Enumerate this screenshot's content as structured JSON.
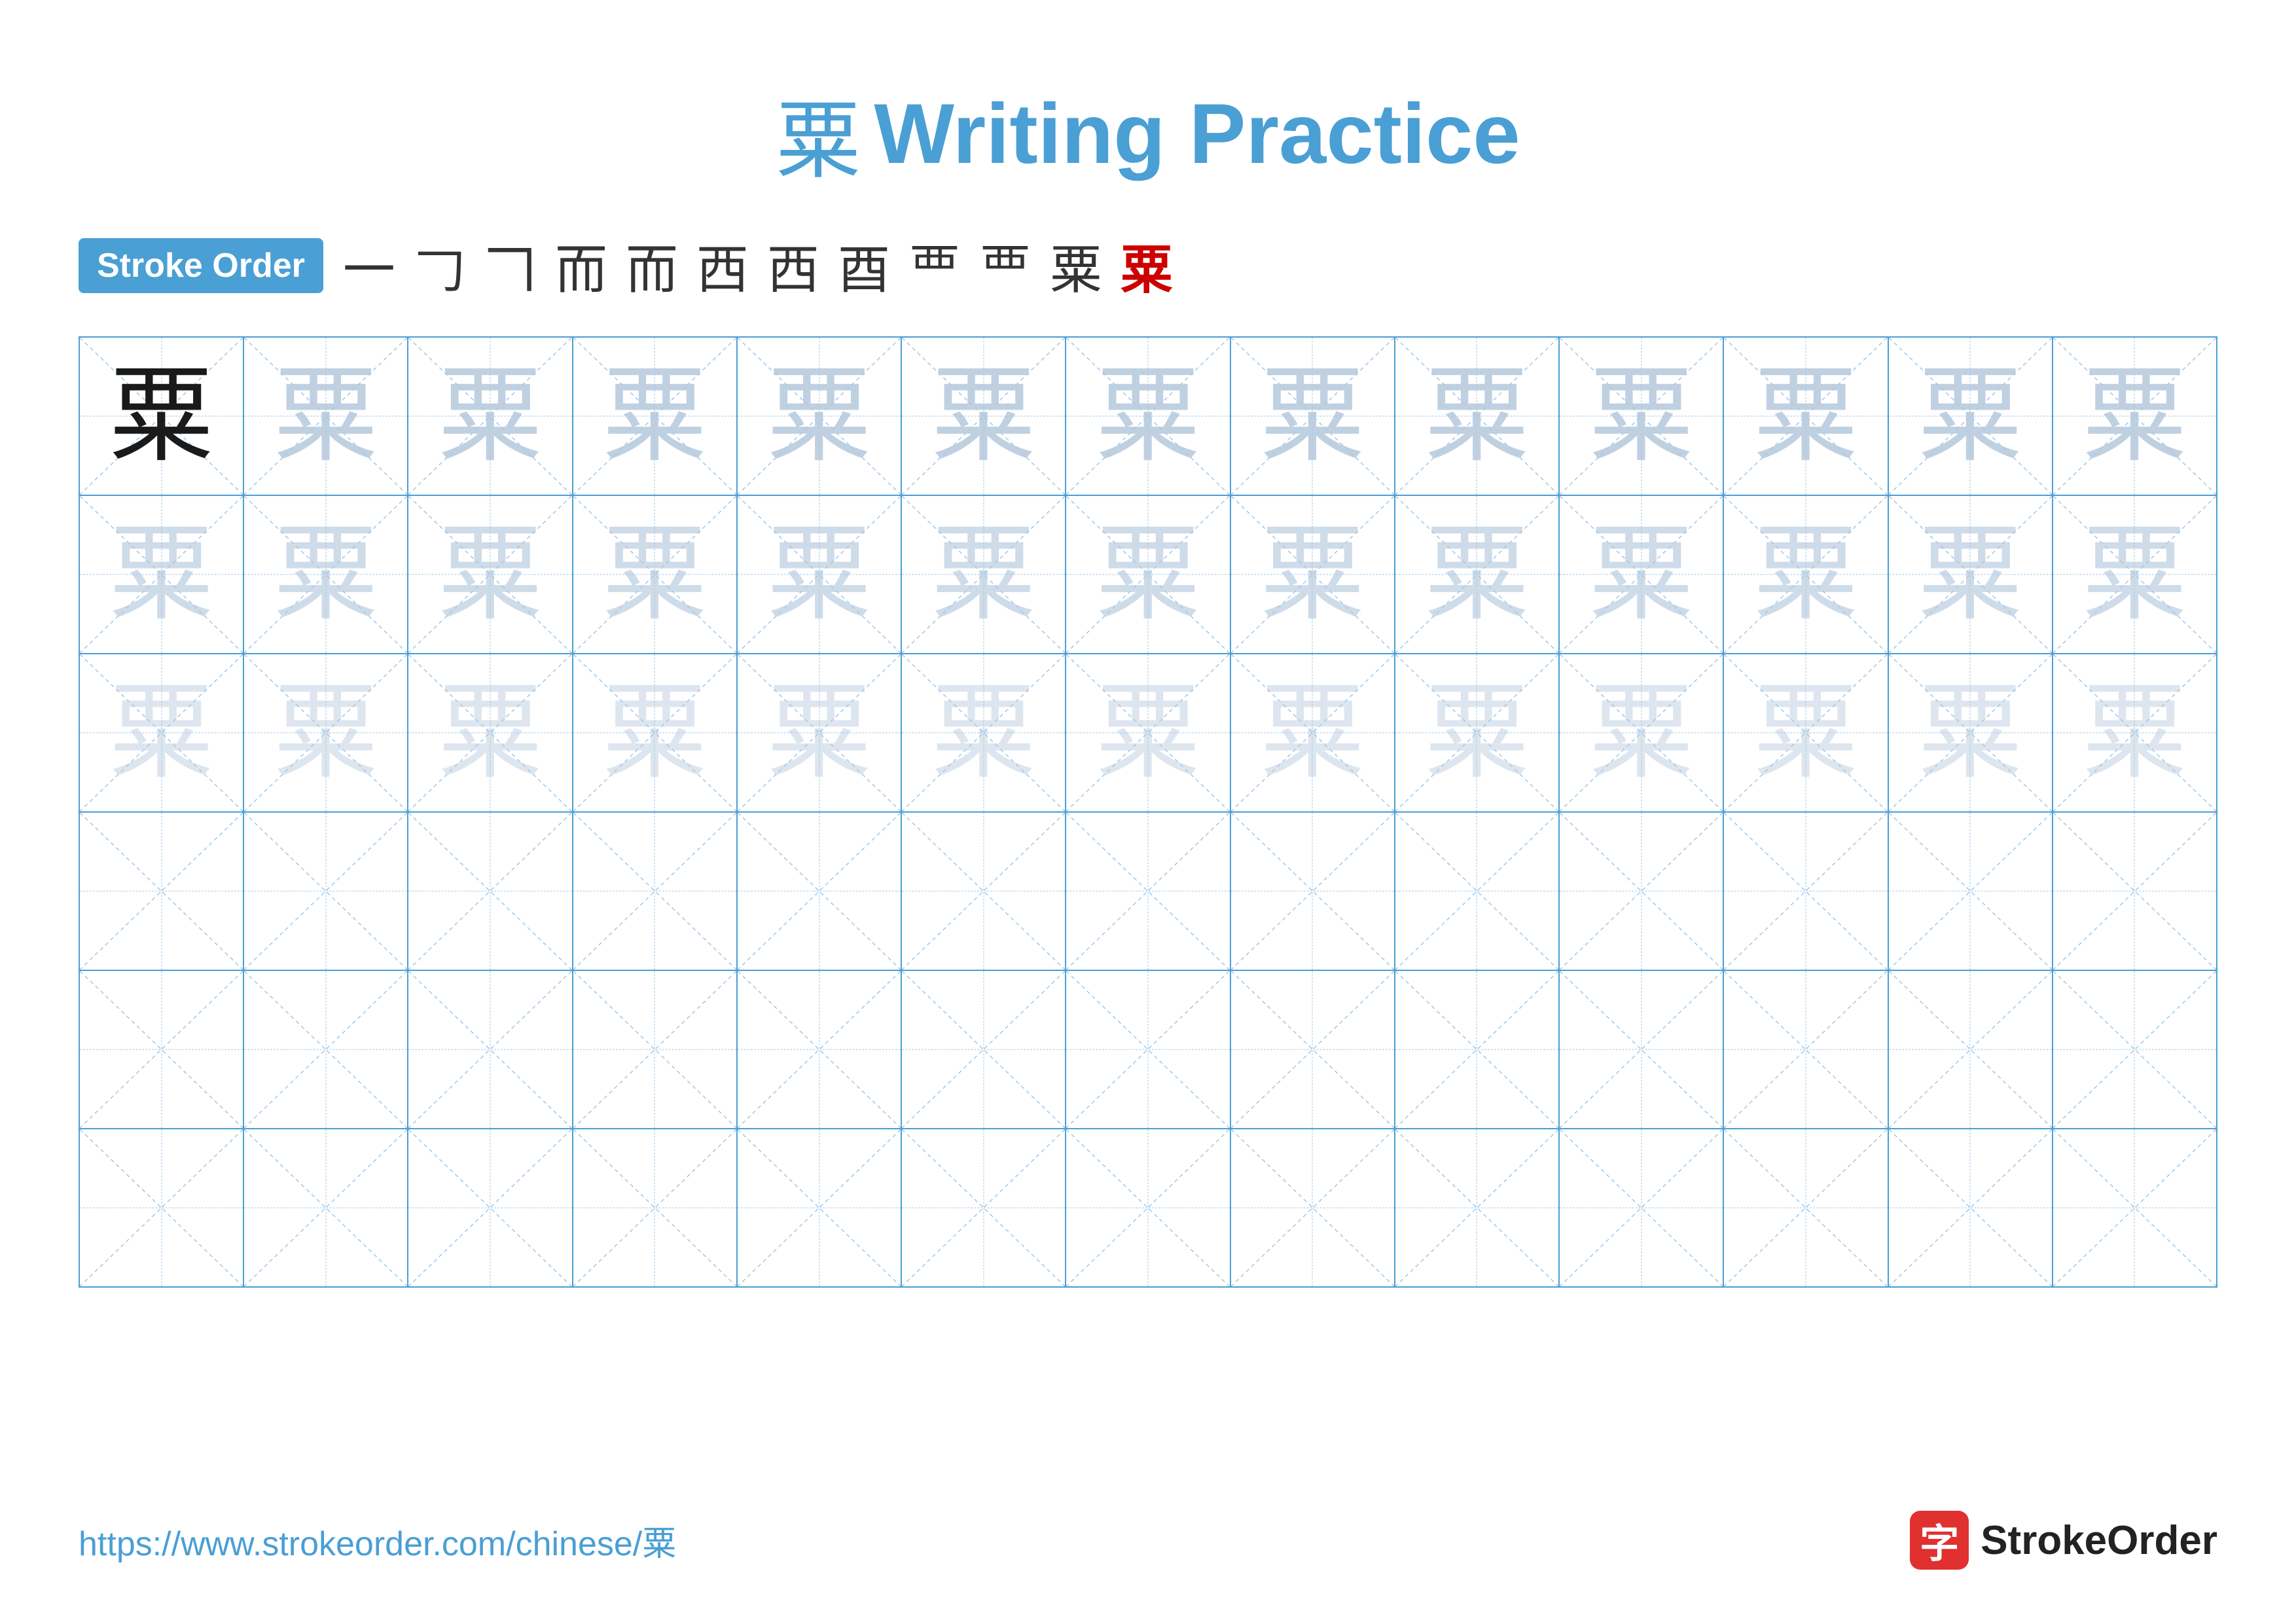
{
  "title": {
    "char": "粟",
    "text": "Writing Practice"
  },
  "stroke_order": {
    "badge_label": "Stroke Order",
    "steps": [
      "一",
      "𠃌",
      "𠃍",
      "而",
      "而",
      "西",
      "西",
      "酉",
      "覀",
      "覀",
      "粟",
      "粟"
    ]
  },
  "grid": {
    "cols": 13,
    "rows": 6,
    "char": "粟",
    "row_types": [
      "ref_fade",
      "fade_medium",
      "fade_light",
      "empty",
      "empty",
      "empty"
    ]
  },
  "footer": {
    "url": "https://www.strokeorder.com/chinese/粟",
    "logo_icon": "字",
    "logo_text": "StrokeOrder"
  }
}
